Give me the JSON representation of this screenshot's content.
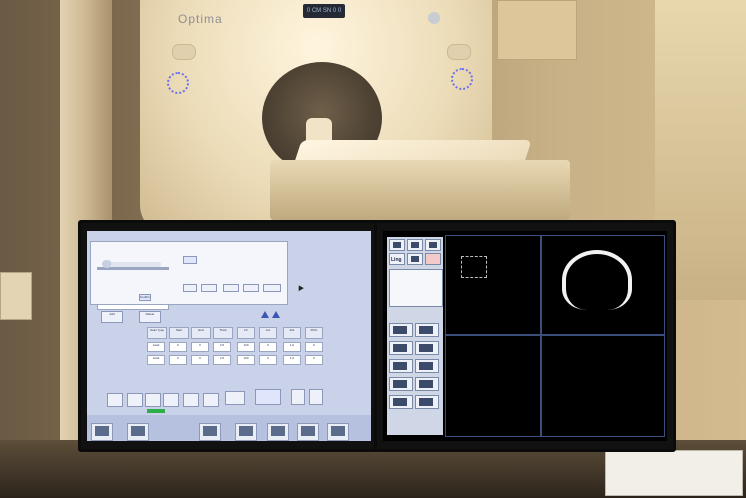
{
  "scene": {
    "gantry_brand": "Optima",
    "gantry_display": "0 CM SN 0 0"
  },
  "left_monitor": {
    "tabs": [
      "Patient",
      "Protocol",
      "Scan",
      "Recon"
    ],
    "confirm_label": "Confirm",
    "table_headers": [
      "Scan Type",
      "Start",
      "End",
      "Thick",
      "kV",
      "mA",
      "Rot",
      "Pitch"
    ],
    "rows": [
      [
        "Axial",
        "0",
        "0",
        "2.5",
        "120",
        "0",
        "1.0",
        "0"
      ],
      [
        "Axial",
        "0",
        "0",
        "2.5",
        "120",
        "0",
        "1.0",
        "0"
      ]
    ],
    "side_buttons": [
      "Add",
      "Delete"
    ],
    "bottom_buttons": [
      "",
      "",
      "",
      "",
      "",
      "",
      ""
    ],
    "start_button": "",
    "taskbar": [
      "",
      "",
      "",
      "",
      "",
      "",
      "",
      ""
    ]
  },
  "right_monitor": {
    "sidebar_labels": [
      "",
      "Ling",
      ""
    ],
    "viewport_text": [
      "",
      "",
      "",
      ""
    ]
  },
  "colors": {
    "left_screen_bg": "#c9d2e8",
    "right_screen_bg": "#000000",
    "accent_green": "#2fae49",
    "icon_blue": "#6a6ff0"
  }
}
